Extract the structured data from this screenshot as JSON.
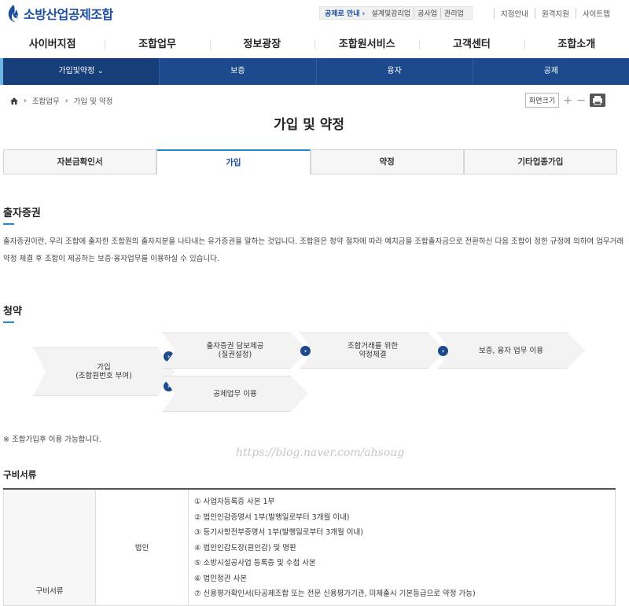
{
  "header": {
    "logo_text": "소방산업공제조합",
    "quick_label": "공제로 안내",
    "quick_links": [
      "설계및감리업",
      "공사업",
      "관리업"
    ],
    "util_links": [
      "지점안내",
      "원격지원",
      "사이트맵"
    ]
  },
  "gnb": [
    "사이버지점",
    "조합업무",
    "정보광장",
    "조합원서비스",
    "고객센터",
    "조합소개"
  ],
  "subnav": [
    "가입및약정",
    "보증",
    "융자",
    "공제"
  ],
  "breadcrumb": [
    "조합업무",
    "가입 및 약정"
  ],
  "tools": {
    "zoom_label": "화면크기",
    "plus": "+",
    "minus": "−"
  },
  "page_title": "가입 및 약정",
  "tabs": [
    "자본금확인서",
    "가입",
    "약정",
    "기타업종가입"
  ],
  "section1": {
    "title": "출자증권",
    "text": "출자증권이란, 우리 조합에 출자한 조합원의 출자지분을 나타내는 유가증권을 말하는 것입니다. 조합원은 청약 절차에 따라 예치금을 조합출자금으로 전환하신 다음 조합이 정한 규정에 의하여 업무거래 약정 체결 후 조합이 제공하는 보증·융자업무를 이용하실 수 있습니다."
  },
  "section2": {
    "title": "청약",
    "steps": {
      "s1a": "가입",
      "s1b": "(조합원번호 부여)",
      "s2a": "출자증권 담보제공",
      "s2b": "(질권설정)",
      "s3a": "조합거래를 위한",
      "s3b": "약정체결",
      "s4": "보증, 융자 업무 이용",
      "s5": "공제업무 이용"
    },
    "note": "※ 조합가입후 이용 가능합니다."
  },
  "watermark": "https://blog.naver.com/ahsoug",
  "section3": {
    "title": "구비서류",
    "row_head": "구비서류",
    "sub_head": "법인",
    "items": [
      "① 사업자등록증 사본 1부",
      "② 법인인감증명서 1부(발행일로부터 3개월 이내)",
      "③ 등기사항전부증명서 1부(발행일로부터 3개월 이내)",
      "④ 법인인감도장(원인감) 및 명판",
      "⑤ 소방시설공사업 등록증 및 수첩 사본",
      "⑥ 법인정관 사본",
      "⑦ 신용평가확인서(타공제조합 또는 전문 신용평가기관, 미제출시 기본등급으로 약정 가능)"
    ]
  }
}
